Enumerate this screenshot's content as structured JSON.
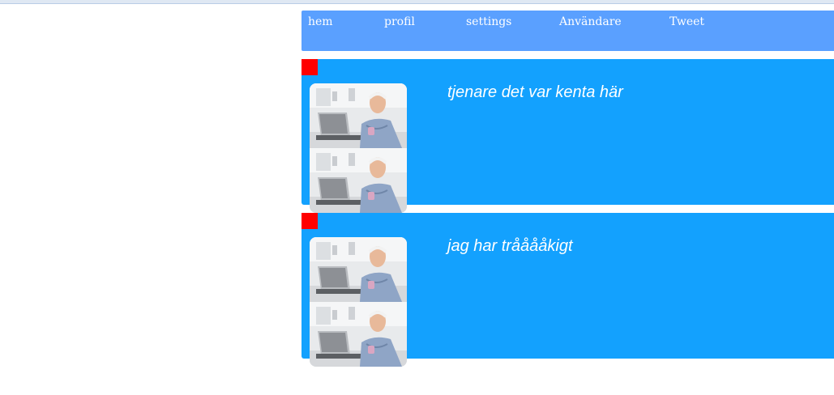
{
  "nav": {
    "items": [
      {
        "label": "hem"
      },
      {
        "label": "profil"
      },
      {
        "label": "settings"
      },
      {
        "label": "Användare"
      },
      {
        "label": "Tweet"
      }
    ]
  },
  "posts": [
    {
      "text": "tjenare det var kenta här"
    },
    {
      "text": "jag har trååååkigt"
    }
  ],
  "colors": {
    "navbar": "#5aa0ff",
    "post_background": "#13a1fe",
    "marker": "#ff0000",
    "text": "#ffffff"
  },
  "icons": {
    "marker": "red-square-icon",
    "avatar": "user-photo-icon"
  }
}
